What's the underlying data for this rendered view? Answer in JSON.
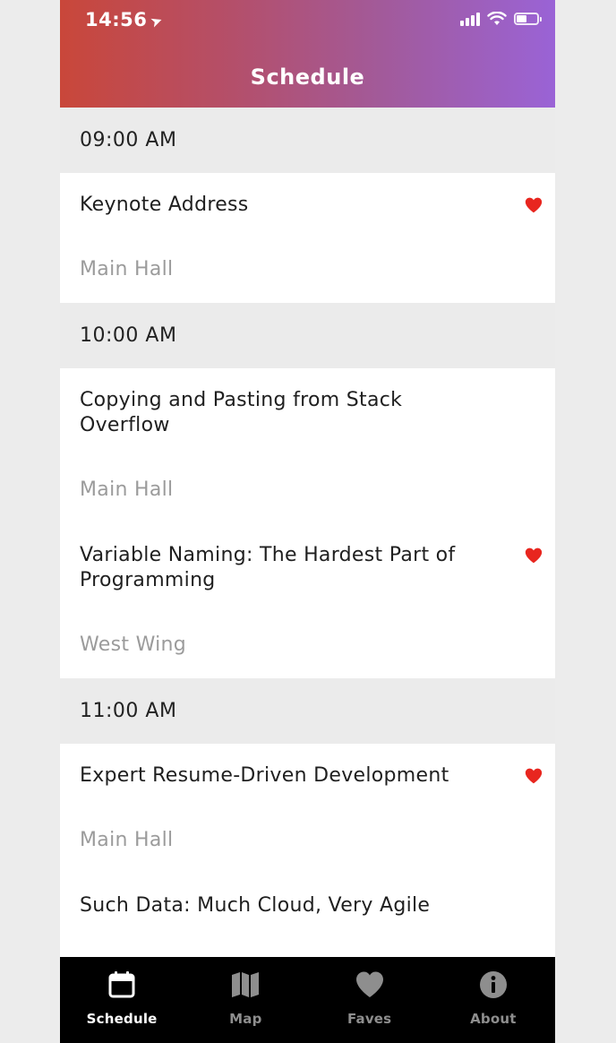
{
  "status_bar": {
    "time": "14:56"
  },
  "header": {
    "title": "Schedule"
  },
  "schedule": [
    {
      "time": "09:00 AM",
      "sessions": [
        {
          "title": "Keynote Address",
          "room": "Main Hall",
          "favorite": true
        }
      ]
    },
    {
      "time": "10:00 AM",
      "sessions": [
        {
          "title": "Copying and Pasting from Stack Overflow",
          "room": "Main Hall",
          "favorite": false
        },
        {
          "title": "Variable Naming: The Hardest Part of Programming",
          "room": "West Wing",
          "favorite": true
        }
      ]
    },
    {
      "time": "11:00 AM",
      "sessions": [
        {
          "title": "Expert Resume-Driven Development",
          "room": "Main Hall",
          "favorite": true
        },
        {
          "title": "Such Data: Much Cloud, Very Agile",
          "room": "",
          "favorite": false
        }
      ]
    }
  ],
  "tabs": [
    {
      "label": "Schedule",
      "icon": "calendar-icon",
      "active": true
    },
    {
      "label": "Map",
      "icon": "map-icon",
      "active": false
    },
    {
      "label": "Faves",
      "icon": "heart-icon",
      "active": false
    },
    {
      "label": "About",
      "icon": "info-icon",
      "active": false
    }
  ],
  "colors": {
    "favorite": "#e8261f",
    "header_gradient_start": "#c9473a",
    "header_gradient_end": "#9a63d6"
  }
}
